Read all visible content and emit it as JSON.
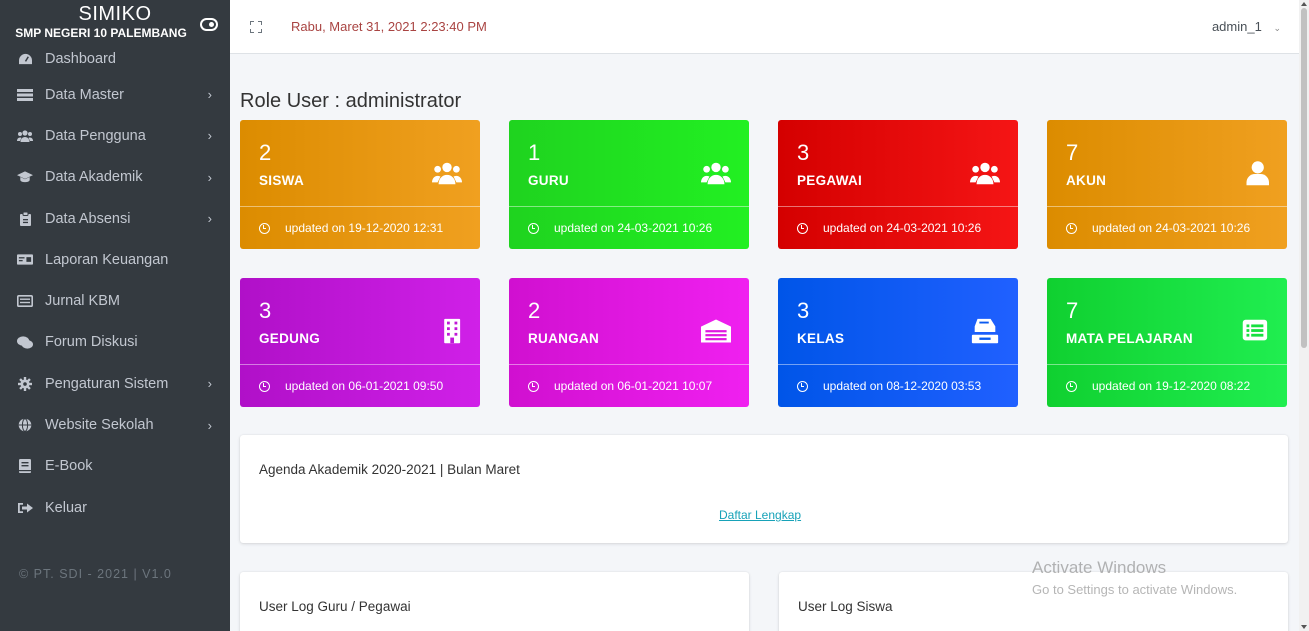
{
  "brand": {
    "title": "SIMIKO",
    "subtitle": "SMP NEGERI 10 PALEMBANG"
  },
  "sidebar": {
    "items": [
      {
        "label": "Dashboard",
        "icon": "dashboard-icon",
        "has_submenu": false
      },
      {
        "label": "Data Master",
        "icon": "list-icon",
        "has_submenu": true
      },
      {
        "label": "Data Pengguna",
        "icon": "users-icon",
        "has_submenu": true
      },
      {
        "label": "Data Akademik",
        "icon": "graduation-cap-icon",
        "has_submenu": true
      },
      {
        "label": "Data Absensi",
        "icon": "clipboard-icon",
        "has_submenu": true
      },
      {
        "label": "Laporan Keuangan",
        "icon": "money-icon",
        "has_submenu": false
      },
      {
        "label": "Jurnal KBM",
        "icon": "book-journal-icon",
        "has_submenu": false
      },
      {
        "label": "Forum Diskusi",
        "icon": "comments-icon",
        "has_submenu": false
      },
      {
        "label": "Pengaturan Sistem",
        "icon": "gear-icon",
        "has_submenu": true
      },
      {
        "label": "Website Sekolah",
        "icon": "globe-icon",
        "has_submenu": true
      },
      {
        "label": "E-Book",
        "icon": "book-icon",
        "has_submenu": false
      },
      {
        "label": "Keluar",
        "icon": "sign-out-icon",
        "has_submenu": false
      }
    ],
    "arrow": "›",
    "footer": "© PT. SDI - 2021 | V1.0"
  },
  "header": {
    "datetime": "Rabu, Maret 31, 2021 2:23:40 PM",
    "user": "admin_1",
    "user_caret": "⌄"
  },
  "main": {
    "role_title": "Role User : administrator",
    "cards": [
      {
        "count": "2",
        "label": "SISWA",
        "updated": "updated on 19-12-2020 12:31",
        "icon": "users-icon",
        "color": "#e8960f"
      },
      {
        "count": "1",
        "label": "GURU",
        "updated": "updated on 24-03-2021 10:26",
        "icon": "users-icon",
        "color": "#22e022"
      },
      {
        "count": "3",
        "label": "PEGAWAI",
        "updated": "updated on 24-03-2021 10:26",
        "icon": "users-icon",
        "color": "#e80a0a"
      },
      {
        "count": "7",
        "label": "AKUN",
        "updated": "updated on 24-03-2021 10:26",
        "icon": "user-icon",
        "color": "#e8960f"
      },
      {
        "count": "3",
        "label": "GEDUNG",
        "updated": "updated on 06-01-2021 09:50",
        "icon": "building-icon",
        "color": "#c018d8"
      },
      {
        "count": "2",
        "label": "RUANGAN",
        "updated": "updated on 06-01-2021 10:07",
        "icon": "warehouse-icon",
        "color": "#e018e0"
      },
      {
        "count": "3",
        "label": "KELAS",
        "updated": "updated on 08-12-2020 03:53",
        "icon": "inbox-tray-icon",
        "color": "#0a5af0"
      },
      {
        "count": "7",
        "label": "MATA PELAJARAN",
        "updated": "updated on 19-12-2020 08:22",
        "icon": "list-alt-icon",
        "color": "#18e040"
      }
    ],
    "agenda": {
      "title": "Agenda Akademik 2020-2021 | Bulan Maret",
      "link": "Daftar Lengkap"
    },
    "log_guru": {
      "title": "User Log Guru / Pegawai"
    },
    "log_siswa": {
      "title": "User Log Siswa"
    }
  },
  "watermark": {
    "title": "Activate Windows",
    "subtitle": "Go to Settings to activate Windows."
  }
}
